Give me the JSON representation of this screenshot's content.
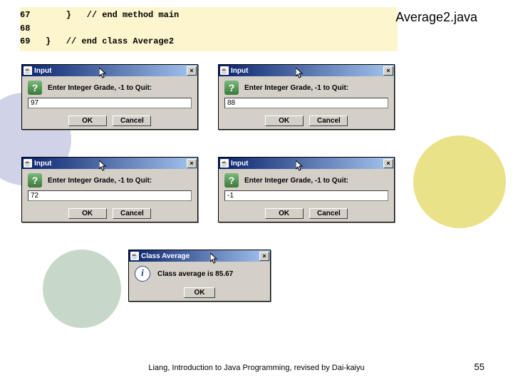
{
  "slide": {
    "title": "Average2.java",
    "footer": "Liang, Introduction to Java Programming, revised by Dai-kaiyu",
    "page_number": "55"
  },
  "code": {
    "lines": [
      "67       }   // end method main",
      "68 ",
      "69   }   // end class Average2"
    ]
  },
  "dialogs": {
    "input_title": "Input",
    "input_prompt": "Enter Integer Grade, -1 to Quit:",
    "ok_label": "OK",
    "cancel_label": "Cancel",
    "close_glyph": "×",
    "q_glyph": "?",
    "i_glyph": "i",
    "java_glyph": "☕",
    "values": {
      "d1": "97",
      "d2": "88",
      "d3": "72",
      "d4": "-1"
    },
    "result_title": "Class Average",
    "result_text": "Class average is 85.67"
  },
  "colors": {
    "circle1": "#d0d2e8",
    "circle2": "#e9e288",
    "circle3": "#c8d8c8"
  }
}
